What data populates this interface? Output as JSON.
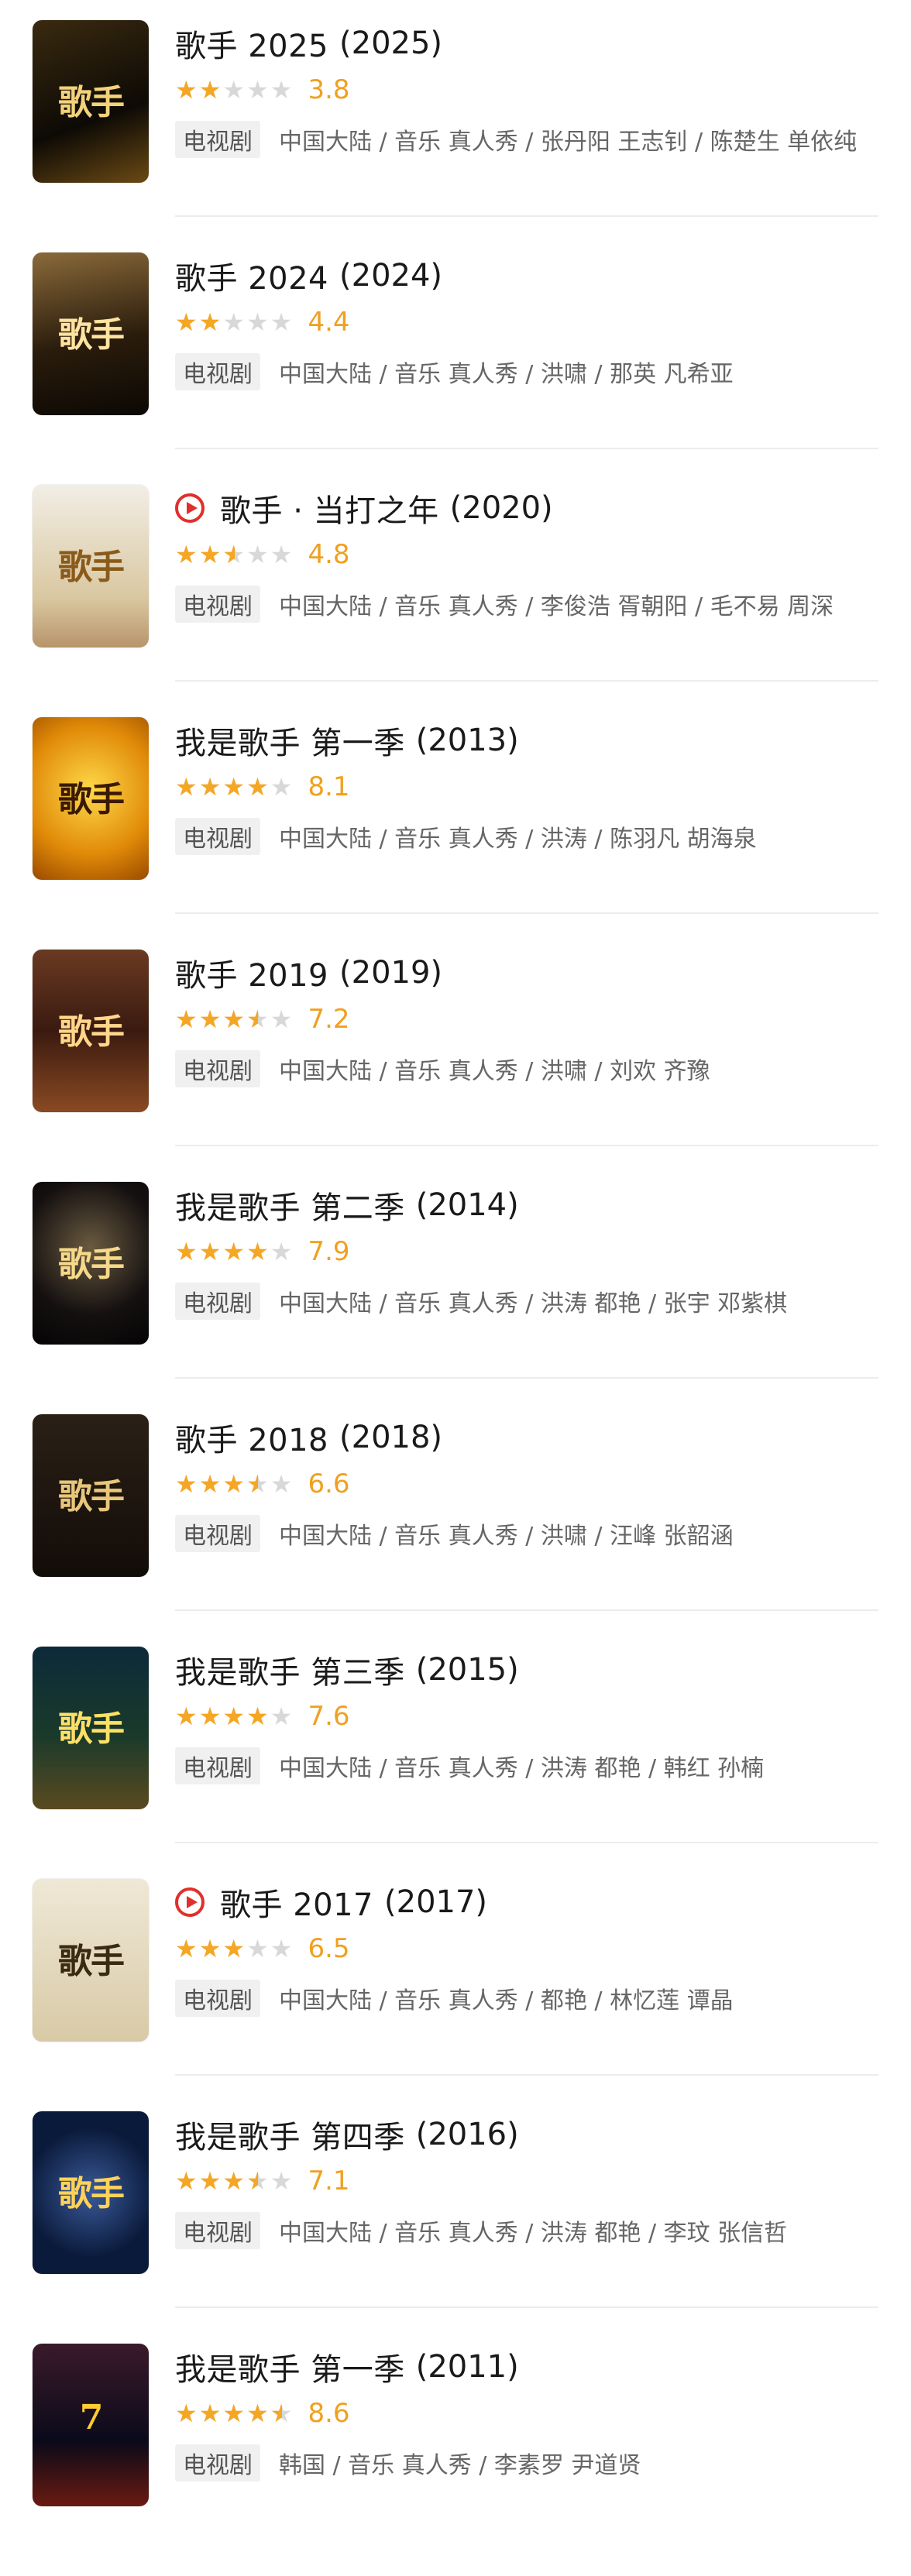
{
  "colors": {
    "star": "#f5a623",
    "score": "#f0a020",
    "play": "#e0302c",
    "tag_bg": "#f0f0f0"
  },
  "items": [
    {
      "title": "歌手 2025",
      "year": "(2025)",
      "playable": false,
      "rating": 3.8,
      "stars_fraction": 0.4,
      "score": "3.8",
      "tag": "电视剧",
      "meta": "中国大陆 / 音乐 真人秀 / 张丹阳 王志钊 / 陈楚生 单依纯",
      "poster": {
        "icon": "poster-image",
        "text": "歌手",
        "sub": "",
        "bg": "linear-gradient(160deg,#3a2a10,#0d0a05 60%,#6b4a14)",
        "fg": "#f3d27a"
      }
    },
    {
      "title": "歌手 2024",
      "year": "(2024)",
      "playable": false,
      "rating": 4.4,
      "stars_fraction": 0.4,
      "score": "4.4",
      "tag": "电视剧",
      "meta": "中国大陆 / 音乐 真人秀 / 洪啸 / 那英 凡希亚",
      "poster": {
        "icon": "poster-image",
        "text": "歌手",
        "sub": "",
        "bg": "linear-gradient(170deg,#8a6a3a,#2a1c0c 55%,#0c0804)",
        "fg": "#ffe3a0"
      }
    },
    {
      "title": "歌手 · 当打之年",
      "year": "(2020)",
      "playable": true,
      "rating": 4.8,
      "stars_fraction": 0.5,
      "score": "4.8",
      "tag": "电视剧",
      "meta": "中国大陆 / 音乐 真人秀 / 李俊浩 胥朝阳 / 毛不易 周深",
      "poster": {
        "icon": "poster-image",
        "text": "歌手",
        "sub": "",
        "bg": "linear-gradient(180deg,#f2eee6,#d9c7a0 70%,#b8946a)",
        "fg": "#8a5a1a"
      }
    },
    {
      "title": "我是歌手 第一季",
      "year": "(2013)",
      "playable": false,
      "rating": 8.1,
      "stars_fraction": 0.8,
      "score": "8.1",
      "tag": "电视剧",
      "meta": "中国大陆 / 音乐 真人秀 / 洪涛 / 陈羽凡 胡海泉",
      "poster": {
        "icon": "poster-image",
        "text": "歌手",
        "sub": "",
        "bg": "radial-gradient(circle at 50% 45%,#ffd94a,#e08a08 60%,#9a4a00)",
        "fg": "#3a1a00"
      }
    },
    {
      "title": "歌手 2019",
      "year": "(2019)",
      "playable": false,
      "rating": 7.2,
      "stars_fraction": 0.7,
      "score": "7.2",
      "tag": "电视剧",
      "meta": "中国大陆 / 音乐 真人秀 / 洪啸 / 刘欢 齐豫",
      "poster": {
        "icon": "poster-image",
        "text": "歌手",
        "sub": "",
        "bg": "linear-gradient(180deg,#6a3a22,#3a1a10 50%,#8a4a22)",
        "fg": "#ffd68a"
      }
    },
    {
      "title": "我是歌手 第二季",
      "year": "(2014)",
      "playable": false,
      "rating": 7.9,
      "stars_fraction": 0.8,
      "score": "7.9",
      "tag": "电视剧",
      "meta": "中国大陆 / 音乐 真人秀 / 洪涛 都艳 / 张宇 邓紫棋",
      "poster": {
        "icon": "poster-image",
        "text": "歌手",
        "sub": "",
        "bg": "radial-gradient(circle at 50% 40%,#6a5a40,#141010 60%,#050404)",
        "fg": "#f5d88a"
      }
    },
    {
      "title": "歌手 2018",
      "year": "(2018)",
      "playable": false,
      "rating": 6.6,
      "stars_fraction": 0.7,
      "score": "6.6",
      "tag": "电视剧",
      "meta": "中国大陆 / 音乐 真人秀 / 洪啸 / 汪峰 张韶涵",
      "poster": {
        "icon": "poster-image",
        "text": "歌手",
        "sub": "",
        "bg": "linear-gradient(180deg,#2a2016,#120c08)",
        "fg": "#e8c67a"
      }
    },
    {
      "title": "我是歌手 第三季",
      "year": "(2015)",
      "playable": false,
      "rating": 7.6,
      "stars_fraction": 0.8,
      "score": "7.6",
      "tag": "电视剧",
      "meta": "中国大陆 / 音乐 真人秀 / 洪涛 都艳 / 韩红 孙楠",
      "poster": {
        "icon": "poster-image",
        "text": "歌手",
        "sub": "",
        "bg": "linear-gradient(180deg,#0c2a3a,#1a3a2a 55%,#5a4a20)",
        "fg": "#ffe066"
      }
    },
    {
      "title": "歌手 2017",
      "year": "(2017)",
      "playable": true,
      "rating": 6.5,
      "stars_fraction": 0.6,
      "score": "6.5",
      "tag": "电视剧",
      "meta": "中国大陆 / 音乐 真人秀 / 都艳 / 林忆莲 谭晶",
      "poster": {
        "icon": "poster-image",
        "text": "歌手",
        "sub": "",
        "bg": "linear-gradient(180deg,#efe8d6,#d8caa6)",
        "fg": "#3a2a12"
      }
    },
    {
      "title": "我是歌手 第四季",
      "year": "(2016)",
      "playable": false,
      "rating": 7.1,
      "stars_fraction": 0.7,
      "score": "7.1",
      "tag": "电视剧",
      "meta": "中国大陆 / 音乐 真人秀 / 洪涛 都艳 / 李玟 张信哲",
      "poster": {
        "icon": "poster-image",
        "text": "歌手",
        "sub": "",
        "bg": "radial-gradient(circle at 50% 50%,#3a5a9a,#0a1a3a 65%)",
        "fg": "#ffd25a"
      }
    },
    {
      "title": "我是歌手 第一季",
      "year": "(2011)",
      "playable": false,
      "rating": 8.6,
      "stars_fraction": 0.9,
      "score": "8.6",
      "tag": "电视剧",
      "meta": "韩国 / 音乐 真人秀 / 李素罗 尹道贤",
      "poster": {
        "icon": "poster-image",
        "text": "7",
        "sub": "",
        "bg": "linear-gradient(180deg,#3a1a2a,#0a0a1a 60%,#6a1a10)",
        "fg": "#ffcc33"
      }
    }
  ]
}
